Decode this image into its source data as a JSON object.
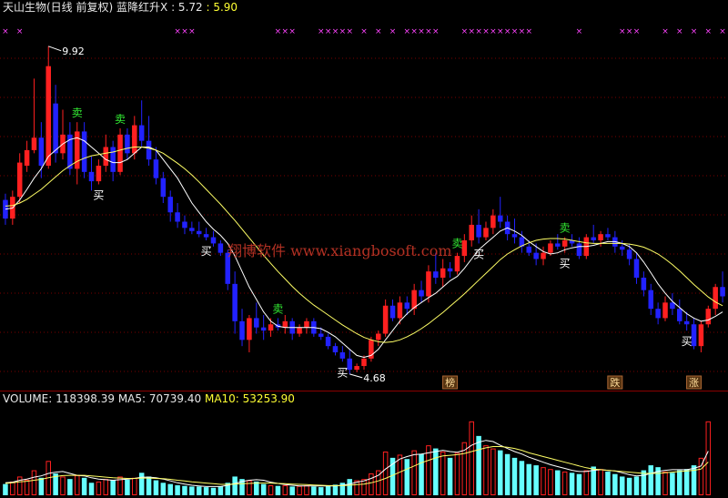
{
  "header": {
    "stock": "天山生物(日线 前复权)",
    "indicator": "蓝降红升X",
    "val1": ": 5.72",
    "val2": ": 5.90"
  },
  "volume_header": {
    "volume": "VOLUME: 118398.39",
    "ma5": "MA5: 70739.40",
    "ma10": "MA10: 53253.90"
  },
  "watermark": "翔博软件 www.xiangbosoft.com",
  "colors": {
    "up": "#ff2020",
    "down": "#2222ff",
    "ma_white": "#ffffff",
    "ma_yellow": "#ffff66",
    "grid": "#7a0000",
    "marker": "#ff44ff",
    "vol_down": "#66ffff"
  },
  "chart_data": [
    {
      "type": "candlestick",
      "name": "price",
      "ylim": [
        4.4,
        10.4
      ],
      "high_label": "9.92",
      "low_label": "4.68",
      "grid": true,
      "candles": [
        [
          7.45,
          7.55,
          7.05,
          7.15
        ],
        [
          7.15,
          7.6,
          7.05,
          7.5
        ],
        [
          7.5,
          8.2,
          7.4,
          8.05
        ],
        [
          8.0,
          8.4,
          7.9,
          8.25
        ],
        [
          8.25,
          9.4,
          8.2,
          8.45
        ],
        [
          8.45,
          8.7,
          7.8,
          8.0
        ],
        [
          8.0,
          9.92,
          7.95,
          9.6
        ],
        [
          9.0,
          9.3,
          8.05,
          8.2
        ],
        [
          8.2,
          8.9,
          8.1,
          8.5
        ],
        [
          8.5,
          8.7,
          7.85,
          7.95
        ],
        [
          7.95,
          8.7,
          7.7,
          8.55
        ],
        [
          8.55,
          8.7,
          7.8,
          7.9
        ],
        [
          7.9,
          8.15,
          7.6,
          7.75
        ],
        [
          7.75,
          8.1,
          7.7,
          8.0
        ],
        [
          8.0,
          8.5,
          7.9,
          8.3
        ],
        [
          8.3,
          8.4,
          7.75,
          7.9
        ],
        [
          7.9,
          8.6,
          7.85,
          8.5
        ],
        [
          8.5,
          8.6,
          8.1,
          8.2
        ],
        [
          8.2,
          8.8,
          8.1,
          8.65
        ],
        [
          8.65,
          9.05,
          8.3,
          8.4
        ],
        [
          8.4,
          8.8,
          8.0,
          8.1
        ],
        [
          8.1,
          8.3,
          7.7,
          7.8
        ],
        [
          7.8,
          7.9,
          7.4,
          7.5
        ],
        [
          7.5,
          7.6,
          7.1,
          7.25
        ],
        [
          7.25,
          7.4,
          7.0,
          7.1
        ],
        [
          7.1,
          7.2,
          6.9,
          7.0
        ],
        [
          7.0,
          7.1,
          6.9,
          6.95
        ],
        [
          6.95,
          7.1,
          6.85,
          6.9
        ],
        [
          6.9,
          7.0,
          6.8,
          6.85
        ],
        [
          6.85,
          6.95,
          6.7,
          6.75
        ],
        [
          6.75,
          6.8,
          6.55,
          6.6
        ],
        [
          6.6,
          6.65,
          6.0,
          6.1
        ],
        [
          6.1,
          6.3,
          5.3,
          5.5
        ],
        [
          5.5,
          5.7,
          5.1,
          5.2
        ],
        [
          5.2,
          5.6,
          5.0,
          5.55
        ],
        [
          5.55,
          5.8,
          5.3,
          5.4
        ],
        [
          5.4,
          5.6,
          5.2,
          5.35
        ],
        [
          5.35,
          5.55,
          5.25,
          5.45
        ],
        [
          5.45,
          5.55,
          5.35,
          5.4
        ],
        [
          5.4,
          5.6,
          5.3,
          5.5
        ],
        [
          5.5,
          5.55,
          5.2,
          5.3
        ],
        [
          5.3,
          5.45,
          5.25,
          5.4
        ],
        [
          5.4,
          5.55,
          5.3,
          5.5
        ],
        [
          5.5,
          5.55,
          5.25,
          5.3
        ],
        [
          5.3,
          5.4,
          5.2,
          5.25
        ],
        [
          5.25,
          5.3,
          5.05,
          5.1
        ],
        [
          5.1,
          5.15,
          4.95,
          5.0
        ],
        [
          5.0,
          5.1,
          4.85,
          4.9
        ],
        [
          4.9,
          5.05,
          4.65,
          4.72
        ],
        [
          4.72,
          4.82,
          4.68,
          4.78
        ],
        [
          4.78,
          4.95,
          4.72,
          4.9
        ],
        [
          4.9,
          5.25,
          4.85,
          5.2
        ],
        [
          5.2,
          5.35,
          5.1,
          5.3
        ],
        [
          5.3,
          5.85,
          5.25,
          5.75
        ],
        [
          5.75,
          5.85,
          5.5,
          5.55
        ],
        [
          5.55,
          5.9,
          5.45,
          5.8
        ],
        [
          5.8,
          5.9,
          5.6,
          5.7
        ],
        [
          5.7,
          6.1,
          5.6,
          6.0
        ],
        [
          6.0,
          6.15,
          5.8,
          5.9
        ],
        [
          5.9,
          6.4,
          5.8,
          6.3
        ],
        [
          6.3,
          6.6,
          6.1,
          6.2
        ],
        [
          6.2,
          6.5,
          6.05,
          6.35
        ],
        [
          6.35,
          6.45,
          6.2,
          6.3
        ],
        [
          6.3,
          6.6,
          6.25,
          6.55
        ],
        [
          6.55,
          6.9,
          6.45,
          6.8
        ],
        [
          6.8,
          7.2,
          6.7,
          7.05
        ],
        [
          7.05,
          7.3,
          6.75,
          6.85
        ],
        [
          6.85,
          7.1,
          6.8,
          7.0
        ],
        [
          7.0,
          7.3,
          6.9,
          7.2
        ],
        [
          7.2,
          7.5,
          7.0,
          7.1
        ],
        [
          7.1,
          7.2,
          6.8,
          6.9
        ],
        [
          6.9,
          7.15,
          6.75,
          6.85
        ],
        [
          6.85,
          6.95,
          6.6,
          6.7
        ],
        [
          6.7,
          6.8,
          6.55,
          6.6
        ],
        [
          6.6,
          6.75,
          6.4,
          6.5
        ],
        [
          6.5,
          6.7,
          6.4,
          6.6
        ],
        [
          6.6,
          6.8,
          6.55,
          6.75
        ],
        [
          6.75,
          6.9,
          6.65,
          6.7
        ],
        [
          6.7,
          6.85,
          6.6,
          6.8
        ],
        [
          6.8,
          6.9,
          6.7,
          6.75
        ],
        [
          6.75,
          6.85,
          6.5,
          6.55
        ],
        [
          6.55,
          6.9,
          6.5,
          6.85
        ],
        [
          6.85,
          7.05,
          6.75,
          6.8
        ],
        [
          6.8,
          6.95,
          6.7,
          6.9
        ],
        [
          6.9,
          7.0,
          6.8,
          6.85
        ],
        [
          6.85,
          6.95,
          6.6,
          6.7
        ],
        [
          6.7,
          6.8,
          6.55,
          6.65
        ],
        [
          6.65,
          6.75,
          6.4,
          6.5
        ],
        [
          6.5,
          6.6,
          6.1,
          6.2
        ],
        [
          6.2,
          6.3,
          5.9,
          6.0
        ],
        [
          6.0,
          6.1,
          5.6,
          5.7
        ],
        [
          5.7,
          5.8,
          5.45,
          5.55
        ],
        [
          5.55,
          5.9,
          5.5,
          5.8
        ],
        [
          5.8,
          5.95,
          5.6,
          5.7
        ],
        [
          5.7,
          5.85,
          5.45,
          5.5
        ],
        [
          5.5,
          5.65,
          5.35,
          5.45
        ],
        [
          5.45,
          5.55,
          5.05,
          5.1
        ],
        [
          5.1,
          5.5,
          5.0,
          5.45
        ],
        [
          5.45,
          5.75,
          5.4,
          5.7
        ],
        [
          5.7,
          6.1,
          5.6,
          6.05
        ],
        [
          6.05,
          6.3,
          5.8,
          5.9
        ]
      ],
      "ma_short": [
        7.3,
        7.32,
        7.45,
        7.62,
        7.8,
        7.95,
        8.15,
        8.25,
        8.35,
        8.42,
        8.45,
        8.4,
        8.3,
        8.2,
        8.1,
        8.05,
        8.05,
        8.1,
        8.2,
        8.3,
        8.3,
        8.25,
        8.1,
        7.95,
        7.8,
        7.6,
        7.4,
        7.25,
        7.1,
        6.98,
        6.88,
        6.75,
        6.55,
        6.3,
        6.05,
        5.85,
        5.65,
        5.5,
        5.42,
        5.4,
        5.4,
        5.4,
        5.4,
        5.4,
        5.38,
        5.32,
        5.25,
        5.15,
        5.05,
        4.95,
        4.92,
        4.95,
        5.05,
        5.2,
        5.35,
        5.5,
        5.62,
        5.72,
        5.8,
        5.88,
        5.95,
        6.05,
        6.15,
        6.22,
        6.35,
        6.5,
        6.65,
        6.75,
        6.85,
        6.95,
        7.0,
        6.95,
        6.88,
        6.78,
        6.7,
        6.62,
        6.58,
        6.6,
        6.65,
        6.68,
        6.7,
        6.7,
        6.72,
        6.75,
        6.78,
        6.78,
        6.75,
        6.7,
        6.6,
        6.45,
        6.28,
        6.1,
        5.95,
        5.82,
        5.72,
        5.62,
        5.55,
        5.5,
        5.52,
        5.58,
        5.65
      ],
      "ma_long": [
        7.35,
        7.36,
        7.4,
        7.46,
        7.54,
        7.62,
        7.72,
        7.82,
        7.92,
        8.0,
        8.07,
        8.12,
        8.16,
        8.18,
        8.2,
        8.22,
        8.25,
        8.28,
        8.3,
        8.3,
        8.28,
        8.25,
        8.2,
        8.12,
        8.04,
        7.95,
        7.85,
        7.74,
        7.62,
        7.5,
        7.38,
        7.25,
        7.12,
        6.98,
        6.84,
        6.7,
        6.56,
        6.43,
        6.3,
        6.18,
        6.06,
        5.95,
        5.85,
        5.76,
        5.68,
        5.6,
        5.52,
        5.44,
        5.37,
        5.3,
        5.24,
        5.2,
        5.17,
        5.16,
        5.17,
        5.2,
        5.25,
        5.31,
        5.38,
        5.46,
        5.55,
        5.64,
        5.74,
        5.84,
        5.94,
        6.05,
        6.16,
        6.27,
        6.38,
        6.49,
        6.58,
        6.65,
        6.71,
        6.76,
        6.8,
        6.82,
        6.83,
        6.83,
        6.82,
        6.8,
        6.78,
        6.76,
        6.75,
        6.75,
        6.75,
        6.75,
        6.75,
        6.74,
        6.72,
        6.69,
        6.64,
        6.58,
        6.5,
        6.41,
        6.31,
        6.2,
        6.09,
        5.99,
        5.89,
        5.81,
        5.75
      ],
      "signals": [
        {
          "type": "sell",
          "label": "卖",
          "index": 16
        },
        {
          "type": "buy",
          "label": "买",
          "index": 20
        },
        {
          "type": "sell",
          "label": "卖",
          "index": 25
        },
        {
          "type": "buy",
          "label": "买",
          "index": 45
        },
        {
          "type": "sell",
          "label": "卖",
          "index": 60
        },
        {
          "type": "buy",
          "label": "买",
          "index": 75
        },
        {
          "type": "sell",
          "label": "卖",
          "index": 100
        },
        {
          "type": "buy",
          "label": "买",
          "index": 105
        },
        {
          "type": "sell",
          "label": "卖",
          "index": 124
        },
        {
          "type": "buy",
          "label": "买",
          "index": 123
        },
        {
          "type": "buy",
          "label": "买",
          "index": 150
        }
      ],
      "top_markers": [
        0,
        2,
        24,
        25,
        26,
        38,
        39,
        40,
        44,
        45,
        46,
        47,
        48,
        50,
        52,
        54,
        56,
        57,
        58,
        59,
        60,
        64,
        65,
        66,
        67,
        68,
        69,
        70,
        71,
        72,
        73,
        80,
        86,
        87,
        88,
        92,
        94,
        96,
        98,
        100,
        101,
        102,
        106,
        116,
        117,
        118,
        120,
        121,
        124,
        125,
        126,
        127,
        128,
        129,
        130,
        131,
        132,
        133,
        134,
        135,
        136,
        137,
        140,
        144,
        151
      ],
      "badges": [
        {
          "label": "榜",
          "index": 98
        },
        {
          "label": "跌",
          "index": 135
        },
        {
          "label": "涨",
          "index": 152
        }
      ]
    },
    {
      "type": "bar",
      "name": "volume",
      "title": "VOLUME",
      "ylim": [
        0,
        140000
      ],
      "volumes": [
        18000,
        22000,
        30000,
        25000,
        40000,
        28000,
        55000,
        35000,
        30000,
        26000,
        32000,
        28000,
        20000,
        22000,
        26000,
        24000,
        30000,
        25000,
        28000,
        36000,
        30000,
        24000,
        20000,
        18000,
        16000,
        15000,
        14000,
        14000,
        13000,
        12000,
        14000,
        20000,
        30000,
        26000,
        24000,
        22000,
        18000,
        16000,
        15000,
        16000,
        14000,
        15000,
        16000,
        14000,
        13000,
        15000,
        17000,
        20000,
        26000,
        24000,
        26000,
        35000,
        40000,
        70000,
        60000,
        65000,
        58000,
        72000,
        66000,
        80000,
        75000,
        70000,
        60000,
        68000,
        85000,
        118398,
        95000,
        80000,
        75000,
        72000,
        66000,
        60000,
        55000,
        50000,
        48000,
        45000,
        42000,
        40000,
        38000,
        36000,
        34000,
        40000,
        46000,
        42000,
        38000,
        34000,
        30000,
        28000,
        30000,
        40000,
        48000,
        45000,
        38000,
        36000,
        40000,
        42000,
        48000,
        60000,
        118398
      ],
      "ma5": [
        20000,
        21000,
        24000,
        26000,
        29000,
        31000,
        35000,
        37000,
        38000,
        35000,
        32000,
        31000,
        28000,
        26000,
        25000,
        24000,
        25000,
        26000,
        27000,
        29000,
        29000,
        28000,
        26000,
        23000,
        20000,
        18000,
        16000,
        15000,
        14000,
        14000,
        14000,
        16000,
        19000,
        22000,
        24000,
        25000,
        24000,
        21000,
        19000,
        17000,
        16000,
        15000,
        15000,
        15000,
        15000,
        15000,
        15000,
        16000,
        18000,
        21000,
        23000,
        27000,
        32000,
        42000,
        50000,
        58000,
        62000,
        65000,
        66000,
        68000,
        70000,
        72000,
        70000,
        69000,
        72000,
        80000,
        85000,
        88000,
        86000,
        80000,
        75000,
        70000,
        66000,
        61000,
        57000,
        53000,
        49000,
        46000,
        43000,
        40000,
        38000,
        38000,
        40000,
        41000,
        40000,
        39000,
        36000,
        33000,
        31000,
        32000,
        35000,
        38000,
        40000,
        41000,
        41000,
        41000,
        43000,
        47000,
        70739
      ],
      "ma10": [
        19000,
        20000,
        21500,
        22500,
        24000,
        25500,
        28000,
        30000,
        31500,
        32000,
        32000,
        32000,
        31000,
        30000,
        29000,
        28000,
        27500,
        27000,
        27000,
        27500,
        27500,
        27000,
        26500,
        25500,
        24000,
        23000,
        21500,
        20500,
        19500,
        18500,
        17500,
        17500,
        18000,
        18500,
        19000,
        19500,
        19500,
        19500,
        19000,
        18500,
        18000,
        17500,
        17000,
        16500,
        16000,
        15500,
        15500,
        15500,
        16000,
        17000,
        18000,
        20000,
        23000,
        27000,
        32000,
        37000,
        42000,
        47000,
        52000,
        56000,
        60000,
        63000,
        64000,
        65000,
        67000,
        70000,
        73000,
        76000,
        78000,
        78000,
        77000,
        75000,
        72000,
        68000,
        65000,
        62000,
        59000,
        56000,
        53000,
        50000,
        47000,
        44000,
        42000,
        41000,
        40000,
        39000,
        38000,
        37000,
        36000,
        35000,
        35000,
        35000,
        36000,
        37000,
        38000,
        39000,
        40000,
        42000,
        53253
      ]
    }
  ]
}
